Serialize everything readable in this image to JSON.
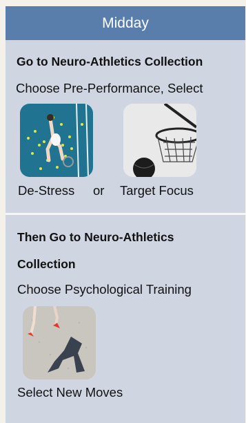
{
  "header": {
    "title": "Midday"
  },
  "section1": {
    "heading": "Go to Neuro-Athletics Collection",
    "instruction": "Choose Pre-Performance, Select",
    "options": [
      {
        "label": "De-Stress",
        "image": "tennis-player-court-image"
      },
      {
        "label": "Target Focus",
        "image": "basketball-hoop-image"
      }
    ],
    "connector": "or"
  },
  "section2": {
    "heading_line1": "Then Go to Neuro-Athletics",
    "heading_line2": "Collection",
    "instruction": "Choose Psychological Training",
    "option": {
      "label": "Select New Moves",
      "image": "runner-shadow-image"
    }
  },
  "colors": {
    "header_bg": "#5a7eac",
    "card_bg": "#cfd6e2",
    "page_bg": "#f3f1ea"
  }
}
